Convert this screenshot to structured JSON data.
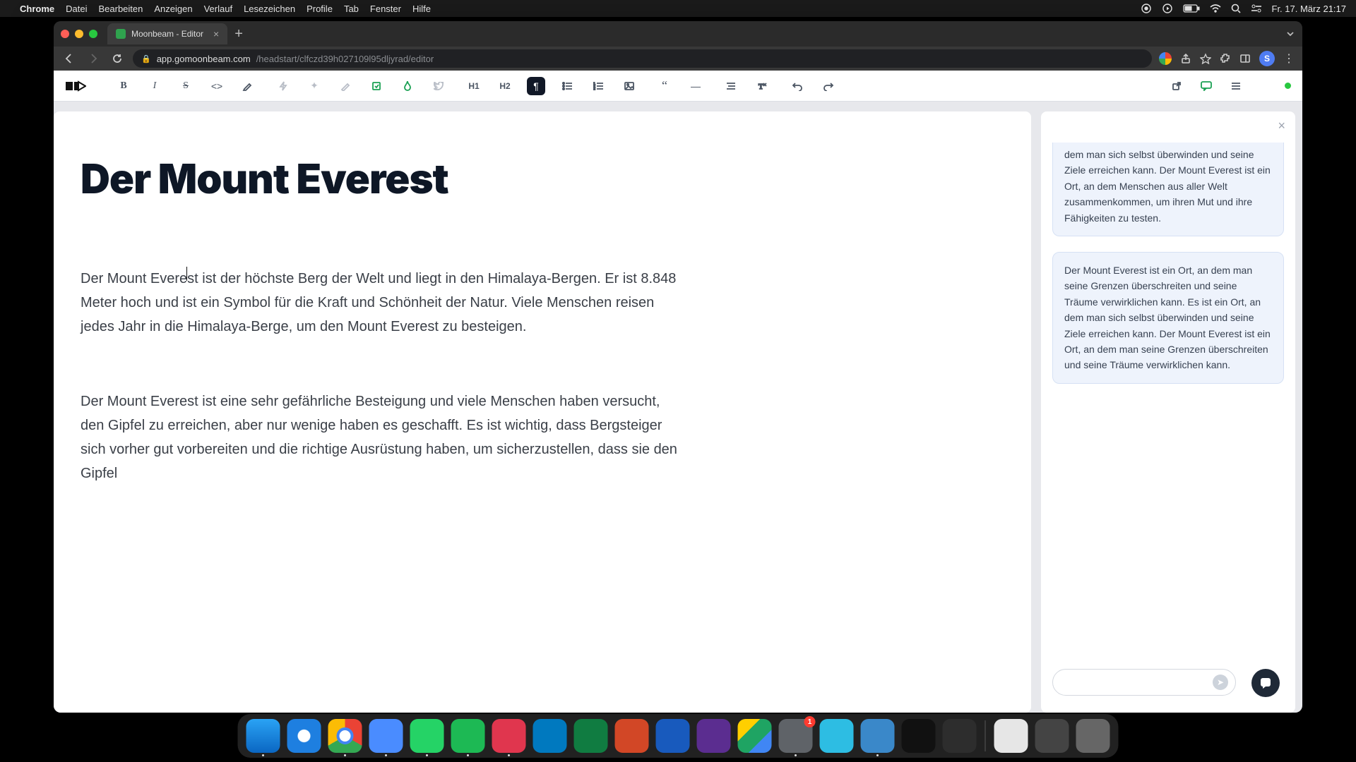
{
  "menubar": {
    "app": "Chrome",
    "items": [
      "Datei",
      "Bearbeiten",
      "Anzeigen",
      "Verlauf",
      "Lesezeichen",
      "Profile",
      "Tab",
      "Fenster",
      "Hilfe"
    ],
    "clock": "Fr. 17. März 21:17"
  },
  "browser": {
    "tab_title": "Moonbeam - Editor",
    "url_domain": "app.gomoonbeam.com",
    "url_path": "/headstart/clfczd39h027109l95dljyrad/editor",
    "profile_initial": "S"
  },
  "toolbar": {
    "h1": "H1",
    "h2": "H2"
  },
  "doc": {
    "title": "Der Mount Everest",
    "p1": "Der Mount Everest ist der höchste Berg der Welt und liegt in den Himalaya-Bergen. Er ist 8.848 Meter hoch und ist ein Symbol für die Kraft und Schönheit der Natur. Viele Menschen reisen jedes Jahr in die Himalaya-Berge, um den Mount Everest zu besteigen.",
    "p2": "Der Mount Everest ist eine sehr gefährliche Besteigung und viele Menschen haben versucht, den Gipfel zu erreichen, aber nur wenige haben es geschafft. Es ist wichtig, dass Bergsteiger sich vorher gut vorbereiten und die richtige Ausrüstung haben, um sicherzustellen, dass sie den Gipfel"
  },
  "panel": {
    "card1": "dem man sich selbst überwinden und seine Ziele erreichen kann. Der Mount Everest ist ein Ort, an dem Menschen aus aller Welt zusammenkommen, um ihren Mut und ihre Fähigkeiten zu testen.",
    "card2": "Der Mount Everest ist ein Ort, an dem man seine Grenzen überschreiten und seine Träume verwirklichen kann. Es ist ein Ort, an dem man sich selbst überwinden und seine Ziele erreichen kann. Der Mount Everest ist ein Ort, an dem man seine Grenzen überschreiten und seine Träume verwirklichen kann.",
    "input_placeholder": ""
  },
  "dock": {
    "settings_badge": "1"
  }
}
